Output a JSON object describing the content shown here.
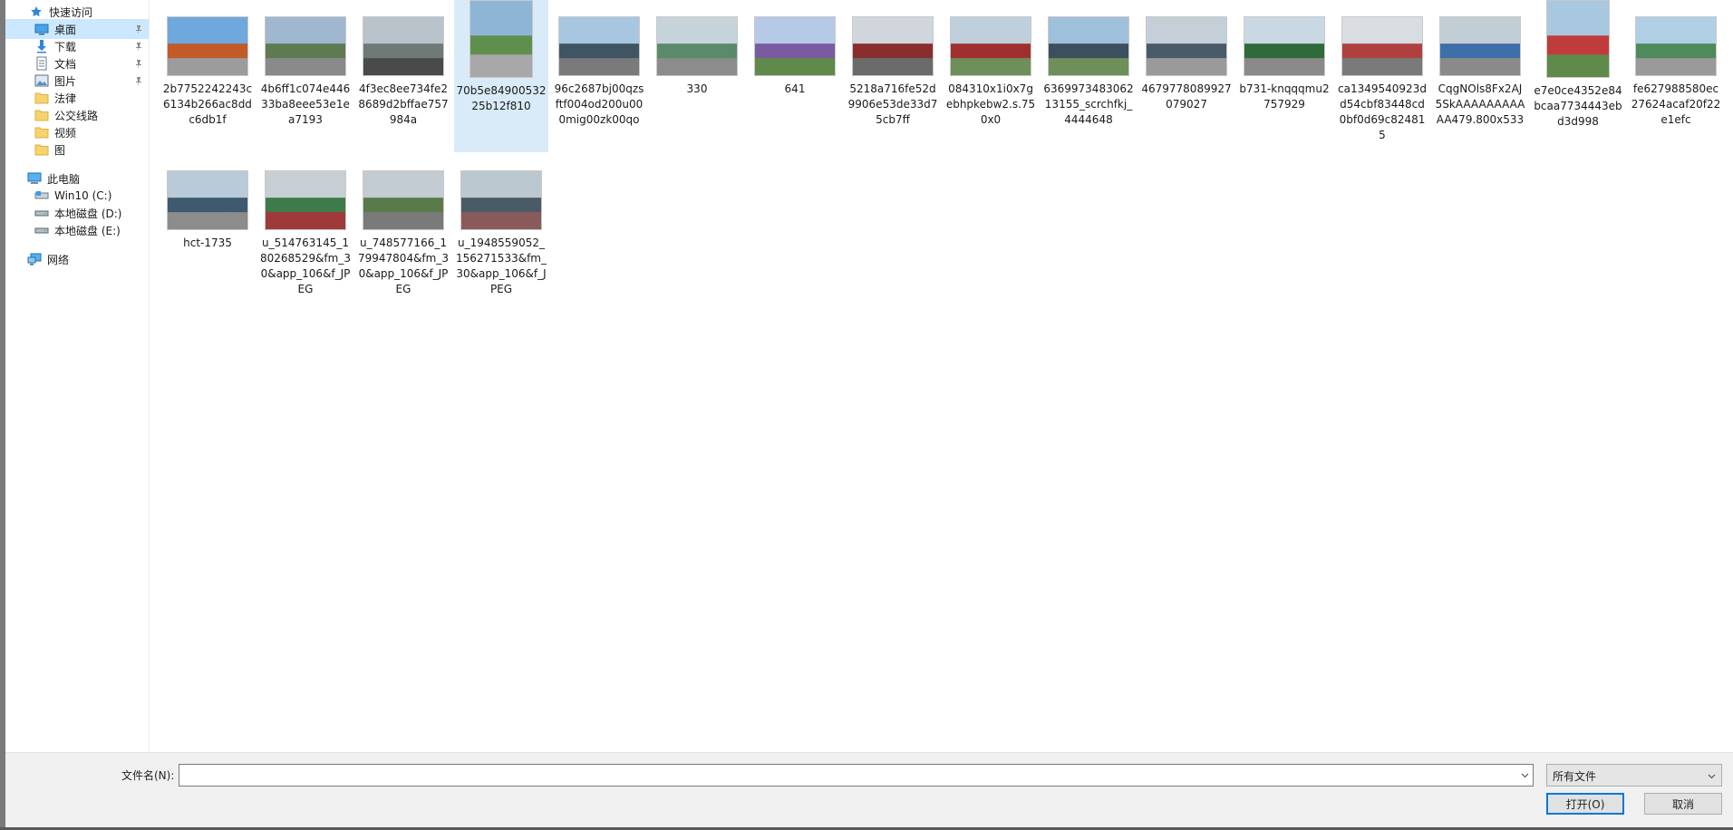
{
  "nav": {
    "items": [
      {
        "label": "快速访问",
        "icon": "star-icon",
        "pinned": false
      },
      {
        "label": "桌面",
        "icon": "desktop-icon",
        "pinned": true
      },
      {
        "label": "下载",
        "icon": "download-icon",
        "pinned": true
      },
      {
        "label": "文档",
        "icon": "document-icon",
        "pinned": true
      },
      {
        "label": "图片",
        "icon": "picture-icon",
        "pinned": true
      },
      {
        "label": "法律",
        "icon": "folder-icon",
        "pinned": false
      },
      {
        "label": "公交线路",
        "icon": "folder-icon",
        "pinned": false
      },
      {
        "label": "视频",
        "icon": "folder-icon",
        "pinned": false
      },
      {
        "label": "图",
        "icon": "folder-icon",
        "pinned": false
      },
      {
        "label": "此电脑",
        "icon": "computer-icon",
        "pinned": false
      },
      {
        "label": "Win10 (C:)",
        "icon": "drive-icon",
        "pinned": false
      },
      {
        "label": "本地磁盘 (D:)",
        "icon": "drive-icon",
        "pinned": false
      },
      {
        "label": "本地磁盘 (E:)",
        "icon": "drive-icon",
        "pinned": false
      },
      {
        "label": "网络",
        "icon": "network-icon",
        "pinned": false
      }
    ]
  },
  "files": [
    {
      "name": "2b7752242243c6134b266ac8ddc6db1f",
      "colors": [
        "#6fa8dc",
        "#c25a2a",
        "#9c9c9c"
      ]
    },
    {
      "name": "4b6ff1c074e44633ba8eee53e1ea7193",
      "colors": [
        "#9fb7cf",
        "#5e7a52",
        "#8a8a8a"
      ]
    },
    {
      "name": "4f3ec8ee734fe28689d2bffae757984a",
      "colors": [
        "#b9c3cc",
        "#6f7a77",
        "#4a4a4a"
      ]
    },
    {
      "name": "70b5e8490053225b12f810",
      "colors": [
        "#8fb5d6",
        "#5f8f4e",
        "#a8a8a8"
      ]
    },
    {
      "name": "96c2687bj00qzsftf004od200u000mig00zk00qo",
      "colors": [
        "#a9c6e0",
        "#3f5563",
        "#7a7a7a"
      ]
    },
    {
      "name": "330",
      "colors": [
        "#c7d3da",
        "#5a8a6a",
        "#8c8c8c"
      ]
    },
    {
      "name": "641",
      "colors": [
        "#b6c9e6",
        "#7a5aa0",
        "#5f8a4a"
      ]
    },
    {
      "name": "5218a716fe52d9906e53de33d75cb7ff",
      "colors": [
        "#d0d6db",
        "#8a2d2d",
        "#6b6b6b"
      ]
    },
    {
      "name": "084310x1i0x7gebhpkebw2.s.750x0",
      "colors": [
        "#bfd0dc",
        "#a03030",
        "#6f8f5a"
      ]
    },
    {
      "name": "636997348306213155_scrchfkj_4444648",
      "colors": [
        "#9fc0db",
        "#3c4f5e",
        "#6e8f5a"
      ]
    },
    {
      "name": "4679778089927079027",
      "colors": [
        "#c5cfd8",
        "#4a5a66",
        "#9a9a9a"
      ]
    },
    {
      "name": "b731-knqqqmu2757929",
      "colors": [
        "#c9d8e2",
        "#2f6b3a",
        "#8a8a8a"
      ]
    },
    {
      "name": "ca1349540923dd54cbf83448cd0bf0d69c824815",
      "colors": [
        "#d8dde2",
        "#b04040",
        "#7a7a7a"
      ]
    },
    {
      "name": "CqgNOls8Fx2AJ5SkAAAAAAAAAAA479.800x533",
      "colors": [
        "#c2ced6",
        "#3f6fa8",
        "#8a8a8a"
      ]
    },
    {
      "name": "e7e0ce4352e84bcaa7734443ebd3d998",
      "colors": [
        "#a8c8e0",
        "#c03c3c",
        "#5f8a4a"
      ]
    },
    {
      "name": "fe627988580ec27624acaf20f22e1efc",
      "colors": [
        "#b0cfe5",
        "#4f8a5a",
        "#9a9a9a"
      ]
    },
    {
      "name": "hct-1735",
      "colors": [
        "#b9cad8",
        "#3f5a6e",
        "#8c8c8c"
      ]
    },
    {
      "name": "u_514763145_180268529&fm_30&app_106&f_JPEG",
      "colors": [
        "#c7cfd4",
        "#3f7a4a",
        "#a03a3a"
      ]
    },
    {
      "name": "u_748577166_179947804&fm_30&app_106&f_JPEG",
      "colors": [
        "#c2ccd2",
        "#5a7a4a",
        "#7a7a7a"
      ]
    },
    {
      "name": "u_1948559052_156271533&fm_30&app_106&f_JPEG",
      "colors": [
        "#bcc8cf",
        "#4a5a66",
        "#8a5a5a"
      ]
    }
  ],
  "footer": {
    "filename_label": "文件名(N):",
    "filename_value": "",
    "filetype": "所有文件",
    "open_label": "打开(O)",
    "cancel_label": "取消"
  }
}
